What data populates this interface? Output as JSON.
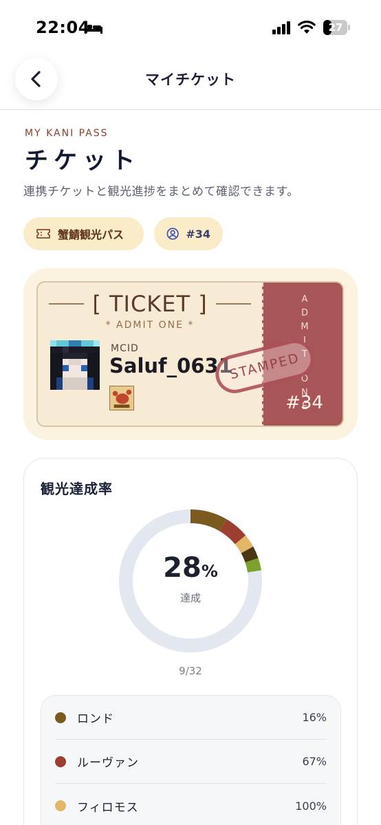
{
  "status_bar": {
    "time": "22:04",
    "battery": "27",
    "icons": [
      "bed-icon",
      "signal-icon",
      "wifi-icon",
      "battery-icon"
    ]
  },
  "header": {
    "title": "マイチケット",
    "back_icon": "chevron-left-icon"
  },
  "intro": {
    "eyebrow": "MY KANI PASS",
    "title": "チケット",
    "description": "連携チケットと観光進捗をまとめて確認できます。"
  },
  "chips": [
    {
      "icon": "ticket-icon",
      "label": "蟹鯖観光パス"
    },
    {
      "icon": "user-circle-icon",
      "label": "#34"
    }
  ],
  "ticket": {
    "heading": "[ TICKET ]",
    "admit": "* ADMIT ONE *",
    "mcid_label": "MCID",
    "mcid_value": "Saluf_0631",
    "stub_letters": [
      "A",
      "D",
      "M",
      "I",
      "T",
      "",
      "O",
      "N",
      "E"
    ],
    "stub_number": "#34",
    "stamp": "STAMPED",
    "colors": {
      "stub": "#a85558",
      "paper": "#f7ebd6",
      "frame": "#fbf3e0"
    }
  },
  "achievement": {
    "title": "観光達成率",
    "percent_value": "28",
    "percent_unit": "%",
    "caption": "達成",
    "ratio": "9/32",
    "ring_track_color": "#e3e7ef",
    "segments": [
      {
        "color": "#7a5a1e",
        "fraction": 0.085
      },
      {
        "color": "#9c3f30",
        "fraction": 0.055
      },
      {
        "color": "#e2b868",
        "fraction": 0.03
      },
      {
        "color": "#4a3612",
        "fraction": 0.028
      },
      {
        "color": "#7ca12c",
        "fraction": 0.028
      }
    ]
  },
  "regions": [
    {
      "name": "ロンド",
      "percent": "16%",
      "color": "#7a5a1e"
    },
    {
      "name": "ルーヴァン",
      "percent": "67%",
      "color": "#9c3f30"
    },
    {
      "name": "フィロモス",
      "percent": "100%",
      "color": "#e2b868"
    }
  ]
}
